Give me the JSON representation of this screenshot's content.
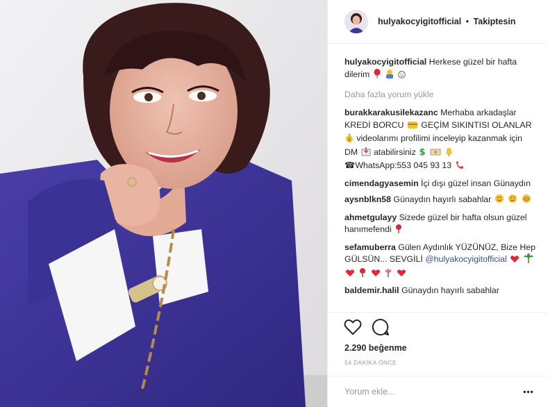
{
  "post": {
    "author": {
      "username": "hulyakocyigitofficial",
      "separator": "•",
      "follow_label": "Takiptesin"
    },
    "caption": {
      "username": "hulyakocyigitofficial",
      "text": "Herkese güzel bir hafta dilerim"
    },
    "load_more_label": "Daha fazla yorum yükle",
    "comments": [
      {
        "username": "burakkarakusilekazanc",
        "line1": "Merhaba arkadaşlar KREDİ BORCU",
        "line2": "GEÇİM SIKINTISI OLANLAR",
        "line3": "videolarımı profilimi inceleyip kazanmak için DM",
        "line4": "atabilirsiniz",
        "line5": "☎WhatsApp:553 045 93 13"
      },
      {
        "username": "cimendagyasemin",
        "text": "İçi dışı güzel insan Günaydın"
      },
      {
        "username": "aysnblkn58",
        "text": "Günaydın hayırlı sabahlar"
      },
      {
        "username": "ahmetgulayy",
        "text": "Sizede güzel bir hafta olsun güzel hanımefendi"
      },
      {
        "username": "sefamuberra",
        "text": "Gülen Aydınlık YÜZÜNÜZ, Bize Hep GÜLSÜN... SEVGİLİ",
        "mention": "@hulyakocyigitofficial"
      },
      {
        "username": "baldemir.halil",
        "text": "Günaydın hayırlı sabahlar"
      }
    ],
    "likes_label": "2.290 beğenme",
    "time_label": "54 DAKİKA ÖNCE",
    "comment_placeholder": "Yorum ekle...",
    "more_label": "•••",
    "icons": {
      "like": "heart-icon",
      "comment": "comment-bubble-icon",
      "more": "more-options-icon"
    }
  }
}
